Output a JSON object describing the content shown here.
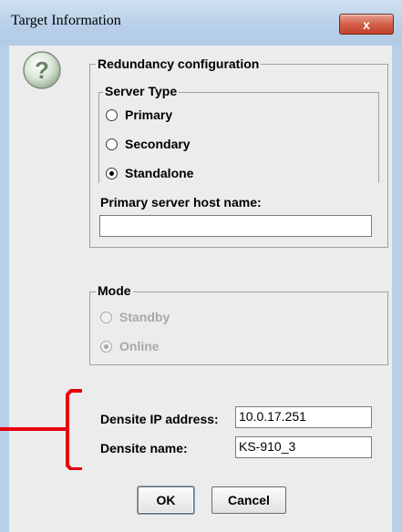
{
  "window": {
    "title": "Target Information",
    "close_symbol": "x"
  },
  "redundancy": {
    "legend": "Redundancy configuration",
    "server_type": {
      "legend": "Server Type",
      "options": [
        {
          "label": "Primary",
          "selected": false
        },
        {
          "label": "Secondary",
          "selected": false
        },
        {
          "label": "Standalone",
          "selected": true
        }
      ]
    },
    "primary_host_label": "Primary server host name:",
    "primary_host_value": ""
  },
  "mode": {
    "legend": "Mode",
    "options": [
      {
        "label": "Standby",
        "selected": false,
        "enabled": false
      },
      {
        "label": "Online",
        "selected": true,
        "enabled": false
      }
    ]
  },
  "densite": {
    "ip_label": "Densite IP address:",
    "ip_value": "10.0.17.251",
    "name_label": "Densite name:",
    "name_value": "KS-910_3"
  },
  "buttons": {
    "ok": "OK",
    "cancel": "Cancel"
  },
  "icons": {
    "help": "question-icon",
    "close": "close-icon"
  },
  "colors": {
    "annotation_red": "#e8000d",
    "titlebar": "#b7cfe8"
  }
}
